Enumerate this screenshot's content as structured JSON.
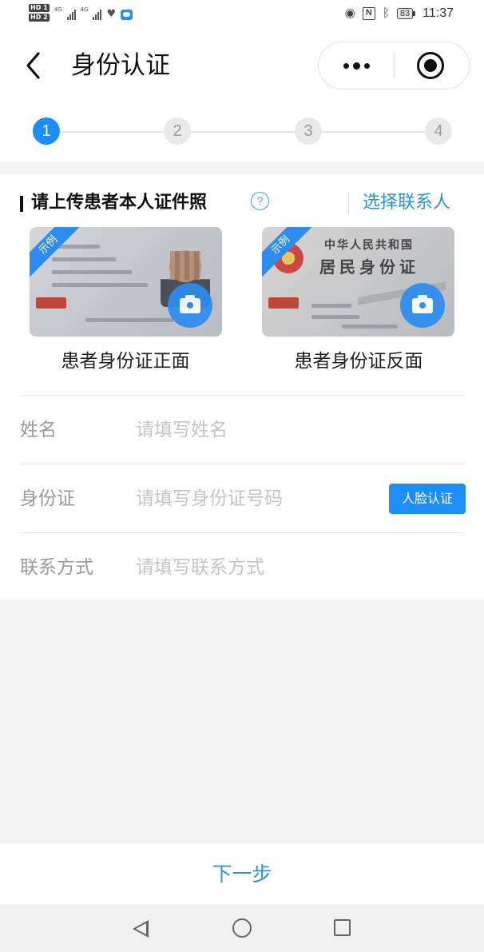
{
  "status_bar": {
    "hd1": "HD 1",
    "hd2": "HD 2",
    "net1": "4G",
    "net2": "4G",
    "battery": "83",
    "time": "11:37",
    "icons": [
      "eye-icon",
      "nfc-icon",
      "bluetooth-icon",
      "battery-icon",
      "heart-icon",
      "cloud-icon"
    ]
  },
  "header": {
    "title": "身份认证"
  },
  "steps": [
    "1",
    "2",
    "3",
    "4"
  ],
  "active_step": 1,
  "upload": {
    "section_title": "请上传患者本人证件照",
    "choose_contact": "选择联系人",
    "sample_tag": "示例",
    "front_caption": "患者身份证正面",
    "back_caption": "患者身份证反面",
    "back_card_line1": "中华人民共和国",
    "back_card_line2": "居民身份证"
  },
  "fields": {
    "name": {
      "label": "姓名",
      "placeholder": "请填写姓名",
      "value": ""
    },
    "id_number": {
      "label": "身份证",
      "placeholder": "请填写身份证号码",
      "value": ""
    },
    "contact": {
      "label": "联系方式",
      "placeholder": "请填写联系方式",
      "value": ""
    }
  },
  "face_verify_label": "人脸认证",
  "next_label": "下一步",
  "colors": {
    "accent": "#1d8ef5",
    "link": "#2b93d8",
    "background": "#f4f4f4"
  }
}
